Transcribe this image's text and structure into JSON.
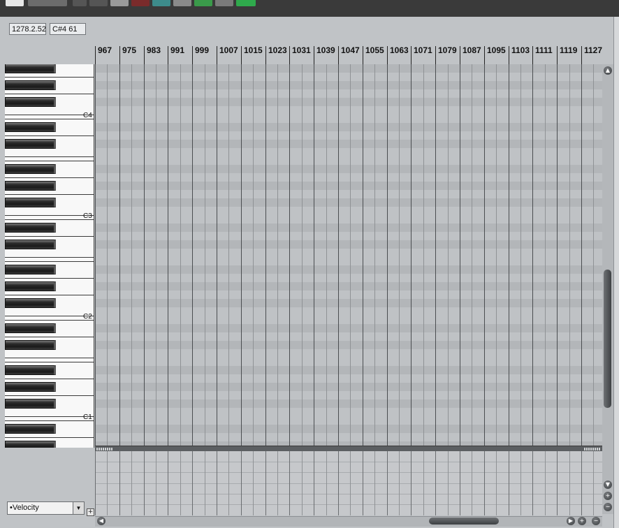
{
  "status": {
    "position": "1278.2.52",
    "note": "C#4  61"
  },
  "ruler": {
    "measures": [
      "967",
      "975",
      "983",
      "991",
      "999",
      "1007",
      "1015",
      "1023",
      "1031",
      "1039",
      "1047",
      "1055",
      "1063",
      "1071",
      "1079",
      "1087",
      "1095",
      "1103",
      "1111",
      "1119",
      "1127"
    ]
  },
  "keyboard": {
    "octave_labels": [
      "C4",
      "C3",
      "C2",
      "C1"
    ]
  },
  "cc_lane": {
    "selected": "•Velocity",
    "add_label": "+"
  },
  "colors": {
    "toolbar_bg": "#3a3a3a",
    "grid_bg": "#bfc2c5",
    "lane_shade": "#b3b6b9",
    "scroll_thumb": "#3e4144"
  },
  "icons": [
    "toolbar-button-icon",
    "scroll-up-icon",
    "scroll-down-icon",
    "zoom-in-icon",
    "zoom-out-icon",
    "scroll-left-icon",
    "scroll-right-icon",
    "dropdown-arrow-icon",
    "add-lane-icon"
  ]
}
